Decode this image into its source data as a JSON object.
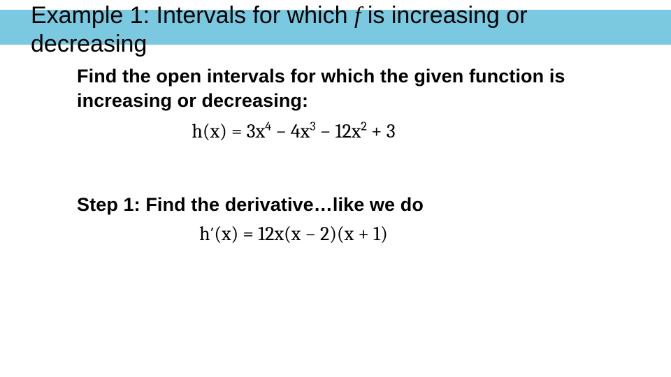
{
  "title": {
    "prefix": "Example 1: Intervals for which ",
    "italic": "f",
    "suffix": " is increasing or decreasing"
  },
  "prompt": "Find the open intervals for which the given function is increasing or decreasing:",
  "function": {
    "lhs": "h(x)",
    "rhs_terms": [
      "3x",
      "4",
      " − 4x",
      "3",
      " − 12x",
      "2",
      " + 3"
    ]
  },
  "step1_label": "Step 1: Find the derivative…like we do",
  "derivative": {
    "lhs": "h′(x)",
    "rhs": "12x(x − 2)(x + 1)"
  }
}
